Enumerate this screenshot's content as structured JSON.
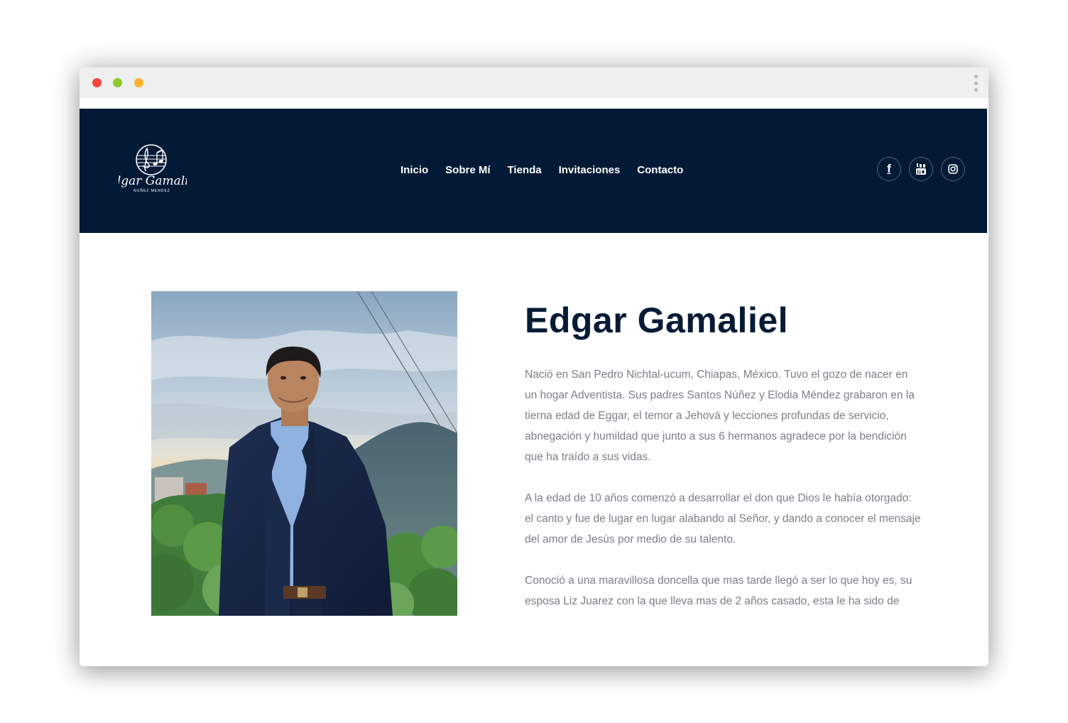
{
  "nav": {
    "items": [
      "Inicio",
      "Sobre Mí",
      "Tienda",
      "Invitaciones",
      "Contacto"
    ]
  },
  "logo": {
    "name": "Edgar Gamaliel",
    "surnames": "NUÑEZ MENDEZ"
  },
  "social": {
    "facebook": "f",
    "youtube_icon": "youtube-icon",
    "instagram_icon": "instagram-icon"
  },
  "about": {
    "name": "Edgar Gamaliel",
    "paragraphs": [
      "Nació en San Pedro Nichtal-ucum, Chiapas, México. Tuvo el gozo de nacer en un hogar Adventista. Sus padres Santos Núñez y Elodia Méndez grabaron en la tierna edad de Eggar, el temor a Jehová y lecciones profundas de servicio, abnegación y humildad que junto a sus 6 hermanos agradece por la bendición que ha traído a sus vidas.",
      "A la edad de 10 años comenzó a desarrollar el don que Dios le había otorgado: el canto y fue de lugar en lugar alabando al Señor, y dando a conocer el mensaje del amor de Jesús por medio de su talento.",
      "Conoció a una maravillosa doncella que mas tarde llegó a ser lo que hoy es, su esposa Liz Juarez con la que lleva mas de 2 años casado, esta le ha sido de mano derecha en el ministerio que Dios le había reservado y juntos viajan a"
    ]
  },
  "colors": {
    "header_bg": "#021a35",
    "title": "#061c36",
    "body_text": "#7b7f86"
  }
}
